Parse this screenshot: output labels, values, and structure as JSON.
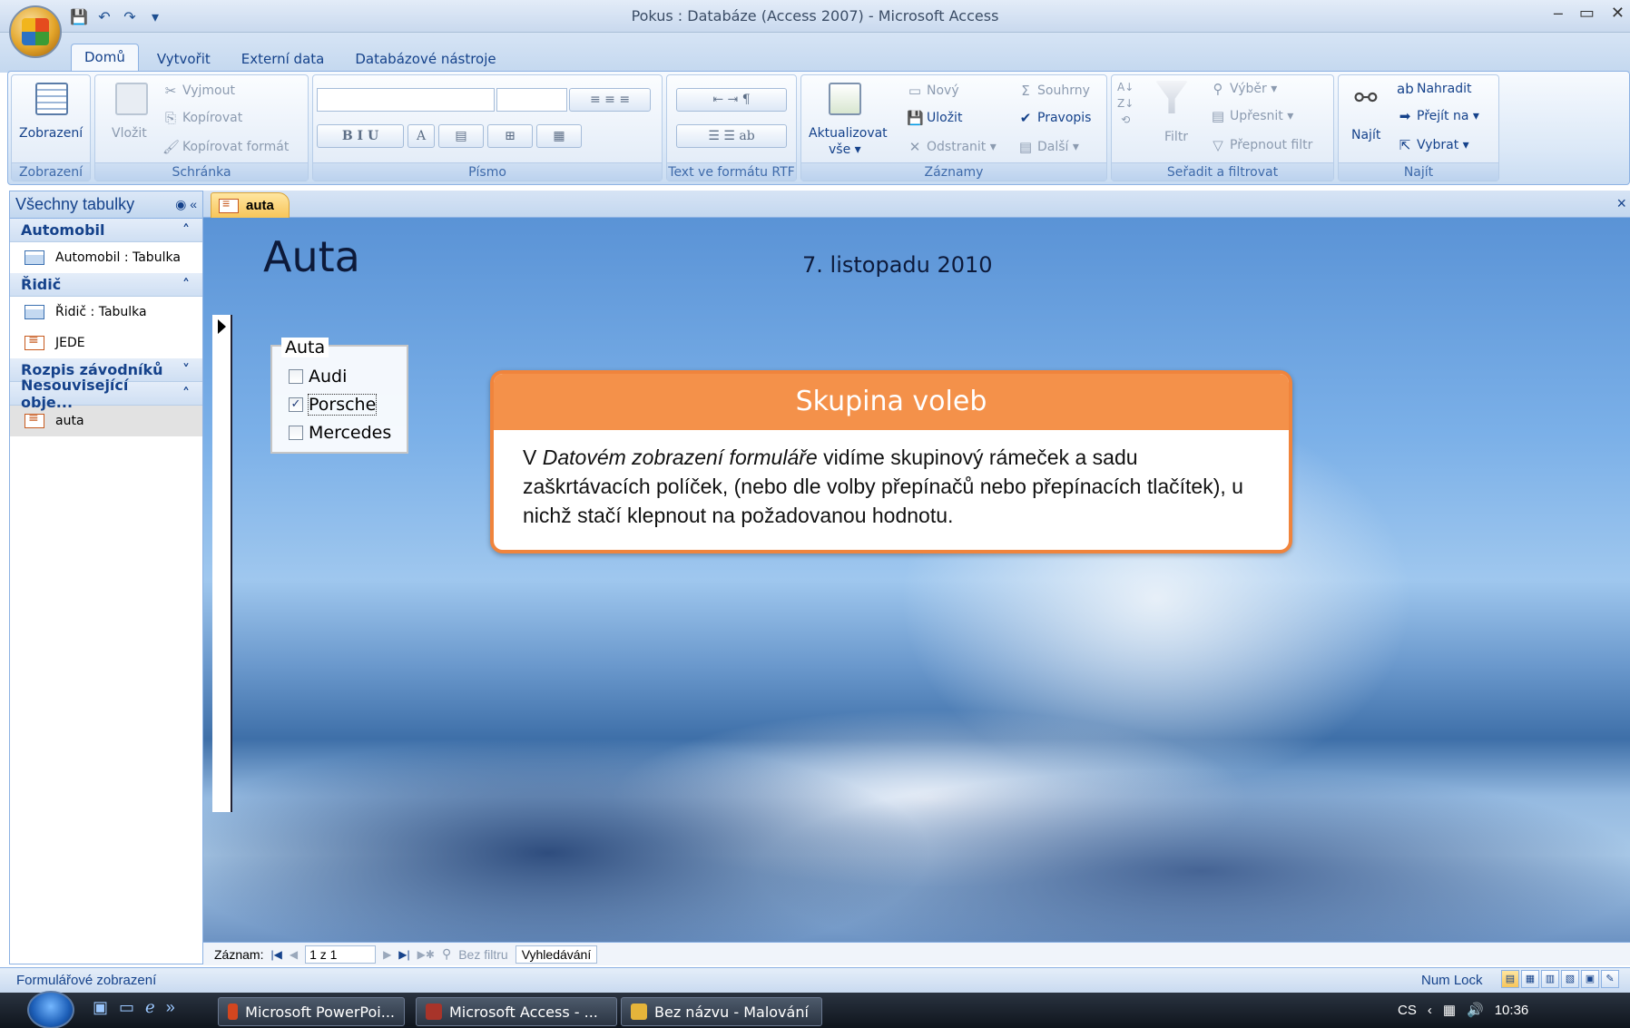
{
  "window": {
    "title": "Pokus : Databáze (Access 2007) - Microsoft Access",
    "controls": [
      "–",
      "▭",
      "✕"
    ]
  },
  "ribbon_tabs": [
    "Domů",
    "Vytvořit",
    "Externí data",
    "Databázové nástroje"
  ],
  "ribbon": {
    "groups": {
      "zobrazeni": "Zobrazení",
      "schranka": "Schránka",
      "pismo": "Písmo",
      "rtf": "Text ve formátu RTF",
      "zaznamy": "Záznamy",
      "seradit": "Seřadit a filtrovat",
      "najit": "Najít"
    },
    "zobrazeni_btn": "Zobrazení",
    "vlozit": "Vložit",
    "vyjmout": "Vyjmout",
    "kopirovat": "Kopírovat",
    "kopirovat_format": "Kopírovat formát",
    "aktualizovat": "Aktualizovat",
    "aktualizovat2": "vše ▾",
    "novy": "Nový",
    "ulozit": "Uložit",
    "odstranit": "Odstranit ▾",
    "souhrny": "Souhrny",
    "pravopis": "Pravopis",
    "dalsi": "Další ▾",
    "filtr": "Filtr",
    "vyber": "Výběr ▾",
    "upresnit": "Upřesnit ▾",
    "prepnout_filtr": "Přepnout filtr",
    "najit_btn": "Najít",
    "nahradit": "Nahradit",
    "prejit_na": "Přejít na ▾",
    "vybrat": "Vybrat ▾"
  },
  "nav": {
    "header": "Všechny tabulky",
    "groups": [
      {
        "label": "Automobil",
        "items": [
          "Automobil : Tabulka"
        ]
      },
      {
        "label": "Řidič",
        "items": [
          "Řidič : Tabulka",
          "JEDE"
        ]
      },
      {
        "label": "Rozpis závodníků",
        "items": []
      },
      {
        "label": "Nesouvisející obje...",
        "items": [
          "auta"
        ]
      }
    ]
  },
  "doc_tab": "auta",
  "form": {
    "title": "Auta",
    "date": "7. listopadu 2010",
    "option_group": {
      "legend": "Auta",
      "options": [
        {
          "label": "Audi",
          "checked": false
        },
        {
          "label": "Porsche",
          "checked": true
        },
        {
          "label": "Mercedes",
          "checked": false
        }
      ]
    }
  },
  "callout": {
    "title": "Skupina voleb",
    "text_pre": "V ",
    "text_em": "Datovém zobrazení formuláře",
    "text_post": " vidíme skupinový rámeček a sadu zaškrtávacích políček, (nebo dle volby přepínačů nebo přepínacích tlačítek), u nichž  stačí klepnout na požadovanou hodnotu."
  },
  "record_nav": {
    "label": "Záznam:",
    "current": "1 z 1",
    "filter": "Bez filtru",
    "search": "Vyhledávání"
  },
  "status": {
    "text": "Formulářové zobrazení",
    "numlock": "Num Lock"
  },
  "taskbar": {
    "tasks": [
      "Microsoft PowerPoi...",
      "Microsoft Access - ...",
      "Bez názvu - Malování"
    ],
    "lang": "CS",
    "time": "10:36"
  }
}
